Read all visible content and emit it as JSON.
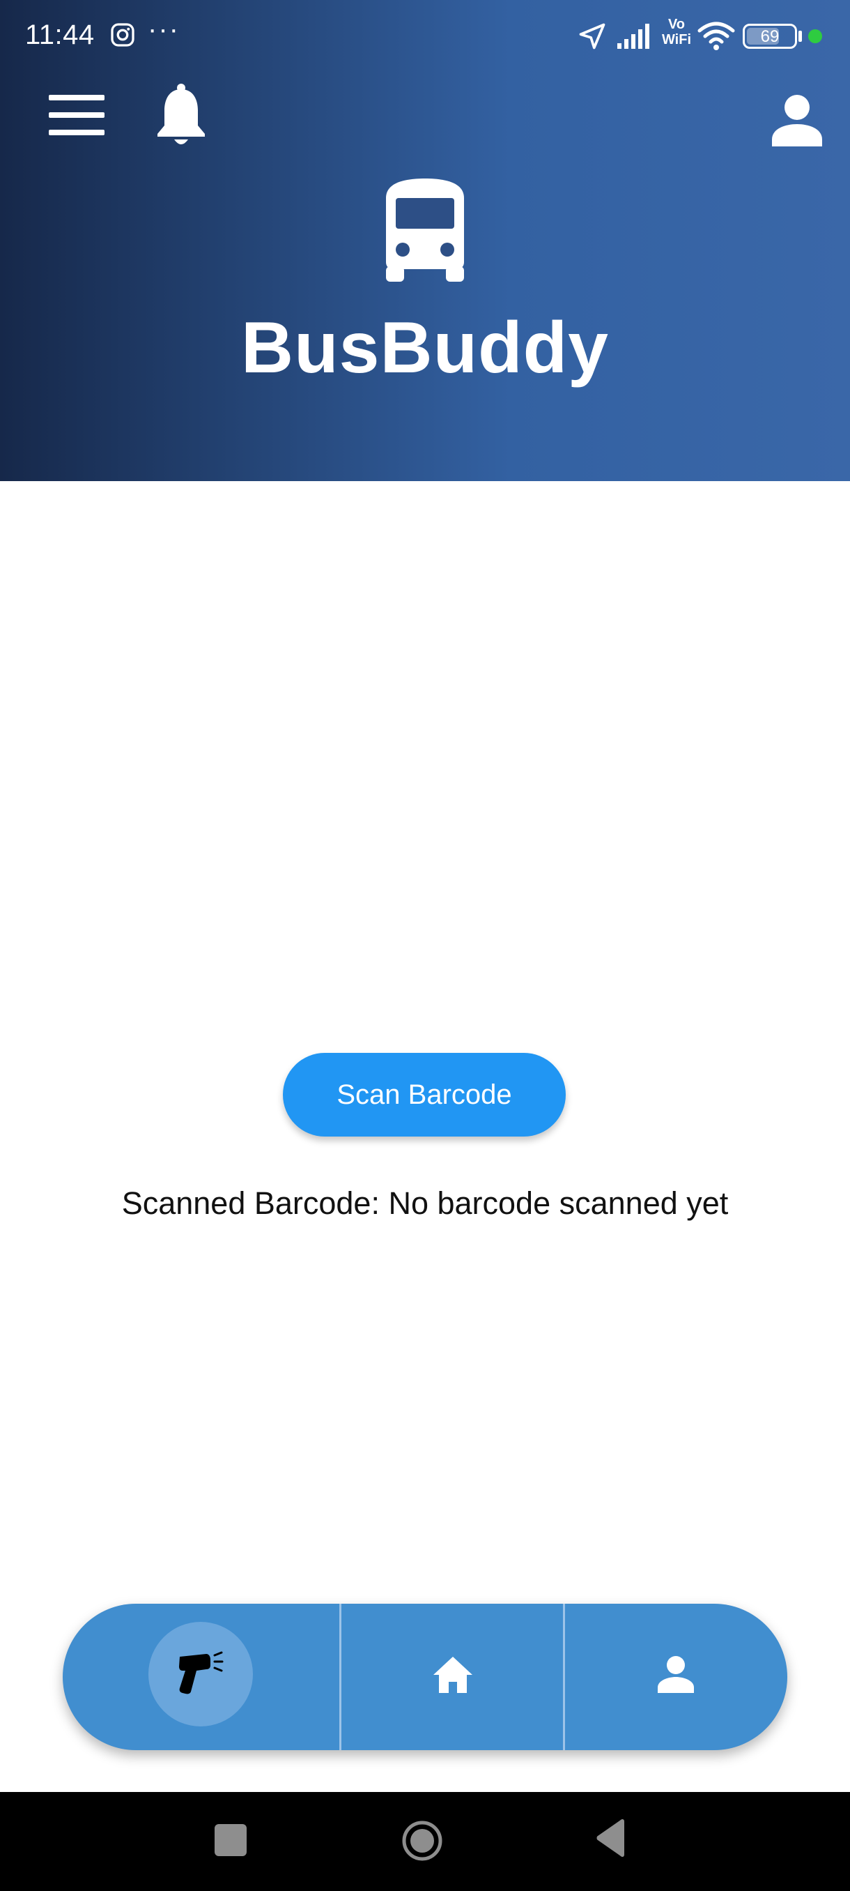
{
  "status_bar": {
    "time": "11:44",
    "more": "···",
    "vowifi_line1": "Vo",
    "vowifi_line2": "WiFi",
    "battery": "69",
    "battery_level_percent": 69,
    "icons": [
      "instagram-icon",
      "location-arrow-icon",
      "signal-icon",
      "wifi-icon",
      "battery-icon"
    ]
  },
  "header": {
    "title": "BusBuddy",
    "icons": [
      "menu-icon",
      "bell-icon",
      "profile-icon",
      "bus-icon"
    ]
  },
  "main": {
    "scan_button_label": "Scan Barcode",
    "scanned_text": "Scanned Barcode: No barcode scanned yet"
  },
  "bottom_nav": {
    "items": [
      {
        "name": "scan",
        "icon": "barcode-scanner-icon",
        "active": true
      },
      {
        "name": "home",
        "icon": "home-icon",
        "active": false
      },
      {
        "name": "profile",
        "icon": "person-icon",
        "active": false
      }
    ]
  },
  "system_nav": {
    "icons": [
      "recent-apps-icon",
      "home-circle-icon",
      "back-triangle-icon"
    ]
  },
  "colors": {
    "header_gradient": [
      "#16284a",
      "#3a67a8"
    ],
    "scan_button": "#2196f3",
    "bottom_nav": "#418ecf",
    "status_dot": "#2ecc40"
  }
}
